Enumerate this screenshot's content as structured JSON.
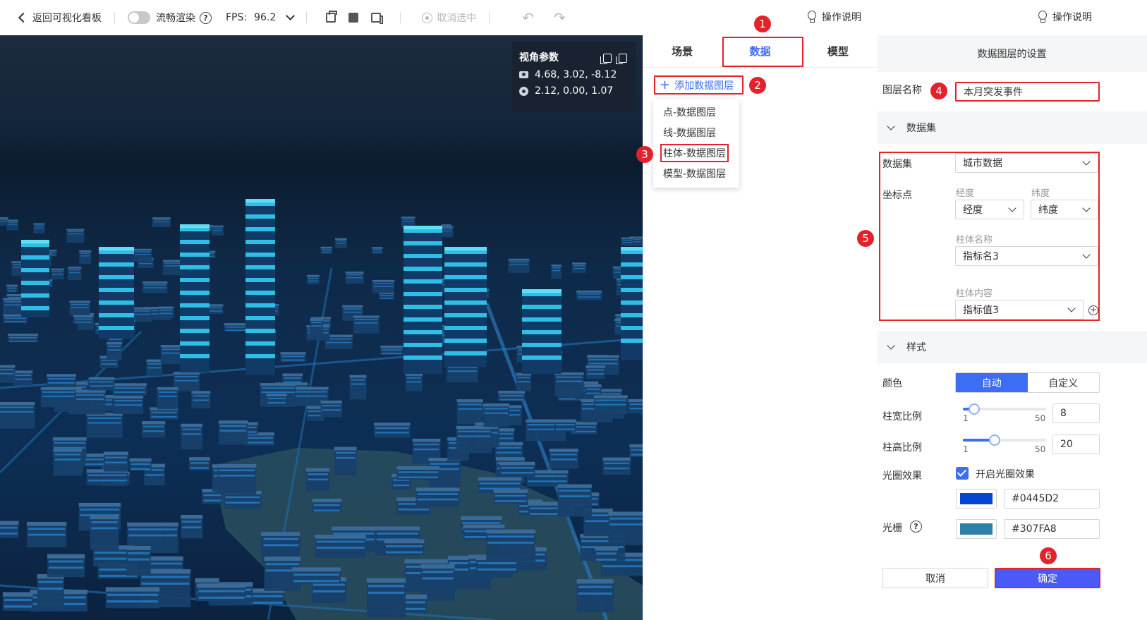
{
  "toolbar": {
    "back_label": "返回可视化看板",
    "smooth_render_label": "流畅渲染",
    "fps_label": "FPS:",
    "fps_value": "96.2",
    "cancel_select_label": "取消选中",
    "help_label": "操作说明"
  },
  "camera_panel": {
    "title": "视角参数",
    "position": "4.68, 3.02, -8.12",
    "target": "2.12, 0.00, 1.07"
  },
  "mid_panel": {
    "tabs": [
      "场景",
      "数据",
      "模型"
    ],
    "active_tab": "数据",
    "add_layer_label": "添加数据图层",
    "layer_types": [
      "点-数据图层",
      "线-数据图层",
      "柱体-数据图层",
      "模型-数据图层"
    ],
    "highlighted_layer_type": "柱体-数据图层"
  },
  "right_panel": {
    "help_label": "操作说明",
    "title": "数据图层的设置",
    "layer_name_label": "图层名称",
    "layer_name_value": "本月突发事件",
    "dataset_section": "数据集",
    "dataset_label": "数据集",
    "dataset_value": "城市数据",
    "coord_label": "坐标点",
    "longitude_label": "经度",
    "longitude_value": "经度",
    "latitude_label": "纬度",
    "latitude_value": "纬度",
    "column_name_label": "柱体名称",
    "column_name_value": "指标名3",
    "column_content_label": "柱体内容",
    "column_content_value": "指标值3",
    "style_section": "样式",
    "color_label": "颜色",
    "color_options": [
      "自动",
      "自定义"
    ],
    "color_selected": "自动",
    "width_ratio_label": "柱宽比例",
    "width_ratio": {
      "min": "1",
      "max": "50",
      "value": "8"
    },
    "height_ratio_label": "柱高比例",
    "height_ratio": {
      "min": "1",
      "max": "50",
      "value": "20"
    },
    "halo_label": "光圈效果",
    "halo_checkbox_label": "开启光圈效果",
    "halo_enabled": true,
    "halo_color": "#0445D2",
    "grating_label": "光栅",
    "grating_color": "#307FA8",
    "cancel_label": "取消",
    "confirm_label": "确定"
  },
  "badges": [
    "1",
    "2",
    "3",
    "4",
    "5",
    "6"
  ],
  "colors": {
    "accent": "#3d6df2",
    "highlight_red": "#e5222c",
    "confirm_button": "#4a5af7"
  }
}
